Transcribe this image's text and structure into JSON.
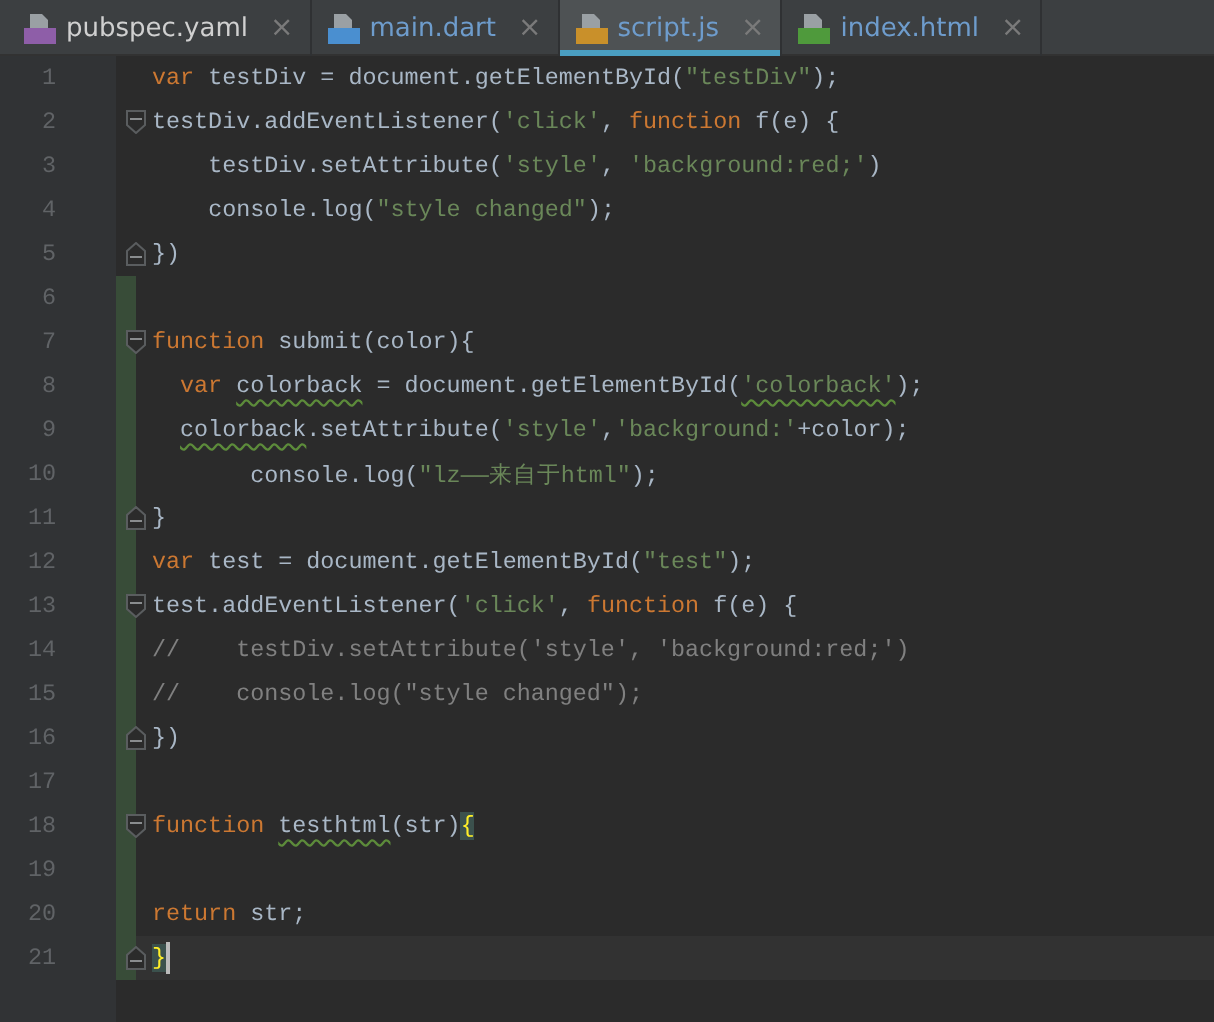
{
  "tabs": [
    {
      "label": "pubspec.yaml",
      "kind": "yaml",
      "close": "×",
      "selected": false,
      "modified": false
    },
    {
      "label": "main.dart",
      "kind": "dart",
      "close": "×",
      "selected": false,
      "modified": true
    },
    {
      "label": "script.js",
      "kind": "js",
      "close": "×",
      "selected": true,
      "modified": true
    },
    {
      "label": "index.html",
      "kind": "html",
      "close": "×",
      "selected": false,
      "modified": true
    }
  ],
  "lines": [
    {
      "number": "1",
      "changed": false,
      "kind": "plain",
      "current": false,
      "tokens": [
        {
          "kind": "keyword",
          "text": "var"
        },
        {
          "kind": "plain",
          "text": " testDiv = document.getElementById("
        },
        {
          "kind": "string",
          "text": "\"testDiv\""
        },
        {
          "kind": "plain",
          "text": ");"
        }
      ]
    },
    {
      "number": "2",
      "changed": false,
      "kind": "opener",
      "current": false,
      "tokens": [
        {
          "kind": "plain",
          "text": "testDiv.addEventListener("
        },
        {
          "kind": "string",
          "text": "'click'"
        },
        {
          "kind": "plain",
          "text": ", "
        },
        {
          "kind": "keyword",
          "text": "function"
        },
        {
          "kind": "plain",
          "text": " f(e) {"
        }
      ]
    },
    {
      "number": "3",
      "changed": false,
      "kind": "plain",
      "current": false,
      "tokens": [
        {
          "kind": "plain",
          "text": "    testDiv.setAttribute("
        },
        {
          "kind": "string",
          "text": "'style'"
        },
        {
          "kind": "plain",
          "text": ", "
        },
        {
          "kind": "string",
          "text": "'background:red;'"
        },
        {
          "kind": "plain",
          "text": ")"
        }
      ]
    },
    {
      "number": "4",
      "changed": false,
      "kind": "plain",
      "current": false,
      "tokens": [
        {
          "kind": "plain",
          "text": "    console.log("
        },
        {
          "kind": "string",
          "text": "\"style changed\""
        },
        {
          "kind": "plain",
          "text": ");"
        }
      ]
    },
    {
      "number": "5",
      "changed": false,
      "kind": "closer",
      "current": false,
      "tokens": [
        {
          "kind": "plain",
          "text": "})"
        }
      ]
    },
    {
      "number": "6",
      "changed": true,
      "kind": "plain",
      "current": false
    },
    {
      "number": "7",
      "changed": true,
      "kind": "opener",
      "current": false,
      "tokens": [
        {
          "kind": "keyword",
          "text": "function"
        },
        {
          "kind": "plain",
          "text": " submit(color){"
        }
      ]
    },
    {
      "number": "8",
      "changed": true,
      "kind": "plain",
      "current": false,
      "tokens": [
        {
          "kind": "keyword",
          "text": "  var "
        },
        {
          "kind": "plain",
          "text": "colorback",
          "typo": true
        },
        {
          "kind": "plain",
          "text": " = document.getElementById("
        },
        {
          "kind": "string",
          "text": "'colorback'",
          "typo": true
        },
        {
          "kind": "plain",
          "text": ");"
        }
      ]
    },
    {
      "number": "9",
      "changed": true,
      "kind": "plain",
      "current": false,
      "tokens": [
        {
          "kind": "plain",
          "text": "  colorback",
          "typo": true
        },
        {
          "kind": "plain",
          "text": ".setAttribute("
        },
        {
          "kind": "string",
          "text": "'style'"
        },
        {
          "kind": "plain",
          "text": ","
        },
        {
          "kind": "string",
          "text": "'background:'"
        },
        {
          "kind": "plain",
          "text": "+color);"
        }
      ]
    },
    {
      "number": "10",
      "changed": true,
      "kind": "plain",
      "current": false,
      "tokens": [
        {
          "kind": "plain",
          "text": "       console.log("
        },
        {
          "kind": "string",
          "text": "\"lz——来自于html\""
        },
        {
          "kind": "plain",
          "text": ");"
        }
      ]
    },
    {
      "number": "11",
      "changed": true,
      "kind": "closer",
      "current": false,
      "tokens": [
        {
          "kind": "plain",
          "text": "}"
        }
      ]
    },
    {
      "number": "12",
      "changed": true,
      "kind": "plain",
      "current": false,
      "tokens": [
        {
          "kind": "keyword",
          "text": "var"
        },
        {
          "kind": "plain",
          "text": " test = document.getElementById("
        },
        {
          "kind": "string",
          "text": "\"test\""
        },
        {
          "kind": "plain",
          "text": ");"
        }
      ]
    },
    {
      "number": "13",
      "changed": true,
      "kind": "opener",
      "current": false,
      "tokens": [
        {
          "kind": "plain",
          "text": "test.addEventListener("
        },
        {
          "kind": "string",
          "text": "'click'"
        },
        {
          "kind": "plain",
          "text": ", "
        },
        {
          "kind": "keyword",
          "text": "function"
        },
        {
          "kind": "plain",
          "text": " f(e) {"
        }
      ]
    },
    {
      "number": "14",
      "changed": true,
      "kind": "plain",
      "current": false,
      "tokens": [
        {
          "kind": "comment",
          "text": "//    testDiv.setAttribute('style', 'background:red;')"
        }
      ]
    },
    {
      "number": "15",
      "changed": true,
      "kind": "plain",
      "current": false,
      "tokens": [
        {
          "kind": "comment",
          "text": "//    console.log(\"style changed\");"
        }
      ]
    },
    {
      "number": "16",
      "changed": true,
      "kind": "closer",
      "current": false,
      "tokens": [
        {
          "kind": "plain",
          "text": "})"
        }
      ]
    },
    {
      "number": "17",
      "changed": true,
      "kind": "plain",
      "current": false
    },
    {
      "number": "18",
      "changed": true,
      "kind": "opener",
      "current": false,
      "tokens": [
        {
          "kind": "keyword",
          "text": "function "
        },
        {
          "kind": "plain",
          "text": "testhtml",
          "typo": true
        },
        {
          "kind": "plain",
          "text": "(str)"
        },
        {
          "kind": "match",
          "text": "{"
        }
      ]
    },
    {
      "number": "19",
      "changed": true,
      "kind": "plain",
      "current": false
    },
    {
      "number": "20",
      "changed": true,
      "kind": "plain",
      "current": false,
      "tokens": [
        {
          "kind": "keyword",
          "text": "return"
        },
        {
          "kind": "plain",
          "text": " str;"
        }
      ]
    },
    {
      "number": "21",
      "changed": true,
      "kind": "closer",
      "current": true,
      "tokens": [
        {
          "kind": "match",
          "text": "}"
        }
      ]
    }
  ]
}
